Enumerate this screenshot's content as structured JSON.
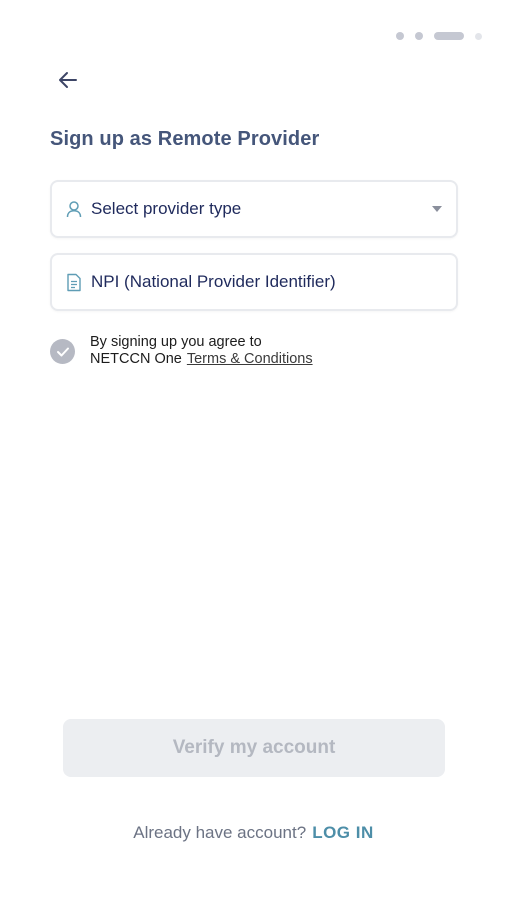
{
  "steps": {
    "total": 4,
    "current": 3
  },
  "header": {
    "title": "Sign up as Remote Provider"
  },
  "form": {
    "provider_type": {
      "placeholder": "Select provider type",
      "icon": "user-icon"
    },
    "npi": {
      "placeholder": "NPI (National Provider Identifier)",
      "icon": "document-icon"
    }
  },
  "agreement": {
    "line1": "By signing up you agree to",
    "line2": "NETCCN One",
    "terms_link": "Terms & Conditions",
    "checked": true
  },
  "actions": {
    "verify_label": "Verify my account"
  },
  "footer": {
    "prompt": "Already have account?",
    "login_label": "LOG IN"
  },
  "colors": {
    "title": "#45567a",
    "link": "#4d8ea8",
    "disabled_button": "#eceef1"
  }
}
